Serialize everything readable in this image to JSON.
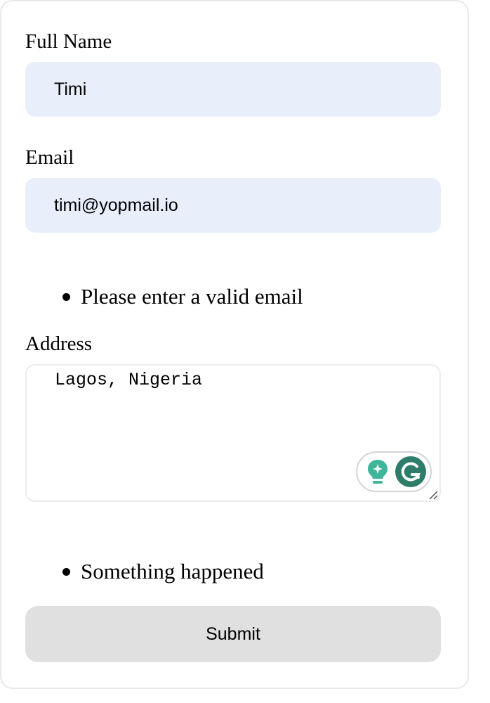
{
  "form": {
    "full_name": {
      "label": "Full Name",
      "value": "Timi"
    },
    "email": {
      "label": "Email",
      "value": "timi@yopmail.io",
      "error": "Please enter a valid email"
    },
    "address": {
      "label": "Address",
      "value": "Lagos, Nigeria",
      "error": "Something happened"
    },
    "submit_label": "Submit"
  },
  "widgets": {
    "grammarly": {
      "assist_icon": "lightbulb-sparkle-icon",
      "logo_icon": "grammarly-g-icon",
      "colors": {
        "bulb": "#3fb59a",
        "logo_bg": "#2e7d6b"
      }
    }
  },
  "colors": {
    "input_bg": "#e8effb",
    "button_bg": "#e0e0e0",
    "border": "#e9e9e9"
  }
}
